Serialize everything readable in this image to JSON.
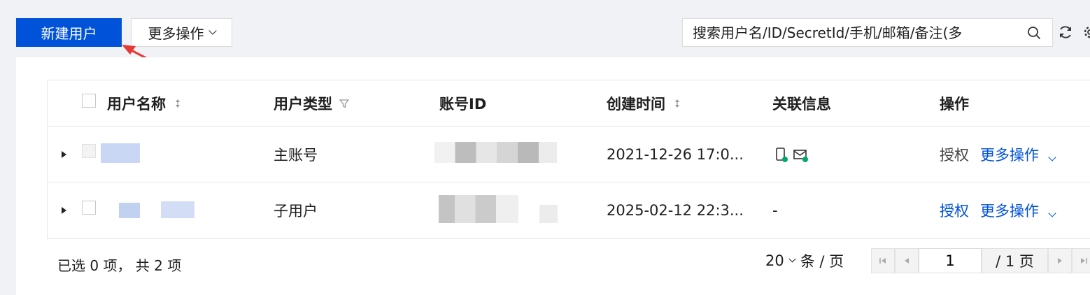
{
  "toolbar": {
    "new_user_label": "新建用户",
    "more_actions_label": "更多操作",
    "search_placeholder": "搜索用户名/ID/SecretId/手机/邮箱/备注(多"
  },
  "icons": [
    "search-icon",
    "refresh-icon",
    "gear-icon",
    "sort-icon",
    "filter-icon",
    "phone-verified-icon",
    "mail-verified-icon"
  ],
  "colors": {
    "primary": "#0052d9",
    "annotation_arrow": "#e53935",
    "verified": "#00a870"
  },
  "table": {
    "columns": [
      "用户名称",
      "用户类型",
      "账号ID",
      "创建时间",
      "关联信息",
      "操作"
    ],
    "rows": [
      {
        "name": "",
        "type": "主账号",
        "account_id": "",
        "created": "2021-12-26 17:0...",
        "related": "",
        "actions": [
          "授权",
          "更多操作"
        ]
      },
      {
        "name": "",
        "type": "子用户",
        "account_id": "",
        "created": "2025-02-12 22:3...",
        "related": "-",
        "actions": [
          "授权",
          "更多操作"
        ]
      }
    ]
  },
  "footer": {
    "selection": "已选 0 项，  共 2 项",
    "page_size": "20",
    "page_size_unit": "条 / 页",
    "page_value": "1",
    "page_total": "/ 1 页"
  }
}
